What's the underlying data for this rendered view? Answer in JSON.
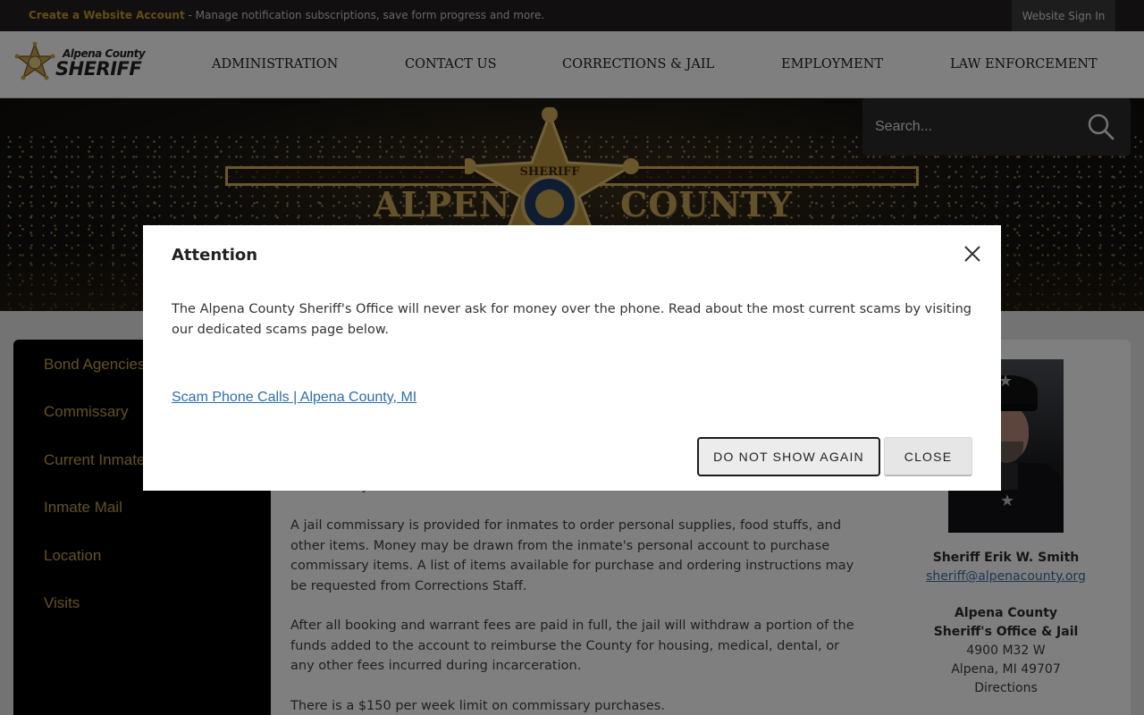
{
  "topbar": {
    "promo_link": "Create a Website Account",
    "promo_text": " - Manage notification subscriptions, save form progress and more.",
    "signin": "Website Sign In"
  },
  "header": {
    "logo_line1": "Alpena County",
    "logo_line2": "SHERIFF",
    "nav": [
      "ADMINISTRATION",
      "CONTACT US",
      "CORRECTIONS & JAIL",
      "EMPLOYMENT",
      "LAW ENFORCEMENT"
    ]
  },
  "hero": {
    "word_left": "ALPENA",
    "word_right": "COUNTY",
    "star_text": "SHERIFF"
  },
  "search": {
    "placeholder": "Search..."
  },
  "sidebar": {
    "items": [
      "Bond Agencies",
      "Commissary",
      "Current Inmates",
      "Inmate Mail",
      "Location",
      "Visits"
    ]
  },
  "content": {
    "partial_line": "commissary items.",
    "paragraphs": [
      "A jail commissary is provided for inmates to order personal supplies, food stuffs, and other items. Money may be drawn from the inmate's personal account to purchase commissary items. A list of items available for purchase and ordering instructions may be requested from Corrections Staff.",
      "After all booking and warrant fees are paid in full, the jail will withdraw a portion of the funds added to the account to reimburse the County for housing, medical, dental, or any other fees incurred during incarceration.",
      "There is a $150 per week limit on commissary purchases."
    ],
    "sheriff_name": "Sheriff Erik W. Smith",
    "sheriff_email": "sheriff@alpenacounty.org",
    "office_name_1": "Alpena County",
    "office_name_2": "Sheriff's Office & Jail",
    "address_1": "4900 M32 W",
    "address_2": "Alpena, MI 49707",
    "directions": "Directions"
  },
  "modal": {
    "title": "Attention",
    "message": "The Alpena County Sheriff's Office will never ask for money over the phone. Read about the most current scams by visiting our dedicated scams page below.",
    "link": "Scam Phone Calls | Alpena County, MI",
    "dont_show": "DO NOT SHOW AGAIN",
    "close": "CLOSE"
  },
  "colors": {
    "accent_gold": "#c8a24a",
    "link_blue": "#2f6ea7",
    "topbar_bg": "#231f20"
  }
}
